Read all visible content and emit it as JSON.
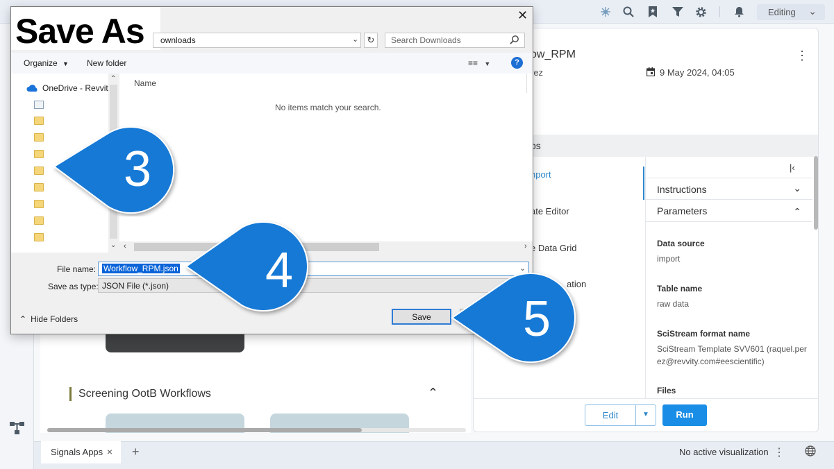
{
  "topbar": {
    "mode_select": "Editing"
  },
  "bottombar": {
    "tab_label": "Signals Apps",
    "visualization_status": "No active visualization"
  },
  "left_content": {
    "section_title": "Screening OotB Workflows"
  },
  "workflow": {
    "title": "ow_RPM",
    "author": "rez",
    "date": "9 May 2024, 04:05",
    "steps_title": "ps",
    "steps": [
      "nport",
      "ate Editor",
      "e Data Grid",
      "ation"
    ],
    "accordions": {
      "instructions": "Instructions",
      "parameters": "Parameters"
    },
    "parameters": [
      {
        "label": "Data source",
        "value": "import"
      },
      {
        "label": "Table name",
        "value": "raw data"
      },
      {
        "label": "SciStream format name",
        "value": "SciStream Template SVV601 (raquel.per ez@revvity.com#eescientific)"
      },
      {
        "label": "Files",
        "value": ""
      }
    ],
    "edit_label": "Edit",
    "run_label": "Run"
  },
  "dialog": {
    "title": "Save As",
    "path": "ownloads",
    "search_placeholder": "Search Downloads",
    "organize_label": "Organize",
    "new_folder_label": "New folder",
    "nav_onedrive": "OneDrive - Revvity",
    "column_name": "Name",
    "empty_message": "No items match your search.",
    "file_name_label": "File name:",
    "file_name_value": "Workflow_RPM.json",
    "save_type_label": "Save as type:",
    "save_type_value": "JSON File (*.json)",
    "hide_folders_label": "Hide Folders",
    "save_label": "Save"
  },
  "callouts": [
    "3",
    "4",
    "5"
  ],
  "colors": {
    "callout_blue": "#1479d6",
    "accent": "#2a86c9",
    "run_button": "#1a8ee6"
  }
}
